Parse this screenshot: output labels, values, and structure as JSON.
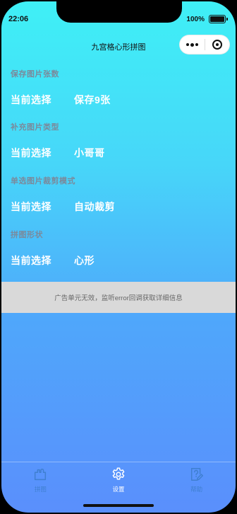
{
  "status": {
    "time": "22:06",
    "battery": "100%"
  },
  "nav": {
    "title": "九宫格心形拼图"
  },
  "sections": [
    {
      "label": "保存图片张数",
      "row_label": "当前选择",
      "value": "保存9张"
    },
    {
      "label": "补充图片类型",
      "row_label": "当前选择",
      "value": "小哥哥"
    },
    {
      "label": "单选图片裁剪模式",
      "row_label": "当前选择",
      "value": "自动裁剪"
    },
    {
      "label": "拼图形状",
      "row_label": "当前选择",
      "value": "心形"
    }
  ],
  "ad": {
    "message": "广告单元无效，监听error回调获取详细信息"
  },
  "tabs": [
    {
      "label": "拼图",
      "icon": "puzzle-icon",
      "active": false
    },
    {
      "label": "设置",
      "icon": "gear-icon",
      "active": true
    },
    {
      "label": "帮助",
      "icon": "help-doc-icon",
      "active": false
    }
  ],
  "colors": {
    "accent_inactive": "#3f7fd0",
    "active": "#ffffff",
    "section_label": "#7a8a9c"
  }
}
